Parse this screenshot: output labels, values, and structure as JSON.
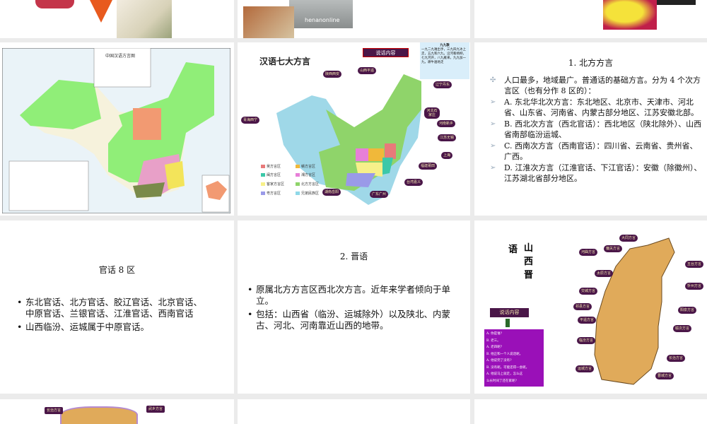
{
  "slides": [
    {
      "id": 1,
      "image_caption": ""
    },
    {
      "id": 2,
      "image_caption": "henanonline"
    },
    {
      "id": 3
    },
    {
      "id": 4,
      "map_title": "中国汉语方言图"
    },
    {
      "id": 5,
      "map_title": "汉语七大方言",
      "button": "说话内容",
      "poem_title": "九九歌",
      "poem": "一九二九难出手，三九四九冰上走，五九和六九，沿河看杨柳，七九河开，八九雁来，九九加一九，耕牛遍地走",
      "tags": [
        "陕西西安",
        "山西平遥",
        "辽宁丹东",
        "河北石家庄",
        "河南新乡",
        "江苏无锡",
        "上海",
        "福建莆田",
        "台湾嘉义",
        "广东广州",
        "湖南岳阳",
        "青海西宁"
      ],
      "legend": [
        {
          "label": "吴方言区",
          "color": "#e87a7a"
        },
        {
          "label": "赣方言区",
          "color": "#f0b83a"
        },
        {
          "label": "闽方言区",
          "color": "#3cc8a8"
        },
        {
          "label": "湘方言区",
          "color": "#e77fd8"
        },
        {
          "label": "客家方言区",
          "color": "#f7f08a"
        },
        {
          "label": "北方方言区",
          "color": "#8fd46a"
        },
        {
          "label": "粤方言区",
          "color": "#9a9ae8"
        },
        {
          "label": "兄弟民族区",
          "color": "#8fd8e8"
        }
      ]
    },
    {
      "id": 6,
      "title": "1. 北方方言",
      "paras": [
        "人口最多，地域最广。普通话的基础方言。分为 4 个次方言区（也有分作 8 区的）：",
        "A. 东北华北次方言：东北地区、北京市、天津市、河北省、山东省、河南省、内蒙古部分地区、江苏安徽北部。",
        "B. 西北次方言（西北官话）：西北地区（陕北除外）、山西省南部临汾运城、",
        "C. 西南次方言（西南官话）：四川省、云南省、贵州省、广西。",
        "D. 江淮次方言（江淮官话、下江官话）：安徽（除徽州）、江苏湖北省部分地区。"
      ]
    },
    {
      "id": 7,
      "title": "官话 8 区",
      "bullets": [
        "东北官话、北方官话、胶辽官话、北京官话、中原官话、兰银官话、江淮官话、西南官话",
        "山西临汾、运城属于中原官话。"
      ]
    },
    {
      "id": 8,
      "title": "2. 晋语",
      "bullets": [
        "原属北方方言区西北次方言。近年来学者倾向于单立。",
        "包括：山西省（临汾、运城除外）以及陕北、内蒙古、河北、河南靠近山西的地带。"
      ]
    },
    {
      "id": 9,
      "title_a": "语",
      "title_b": "山西晋",
      "button": "说话内容",
      "dialogue": [
        "A. 你是谁?",
        "B.  老三。",
        "A. 老四呢?",
        "B. 他正和一个人说话呢。",
        "A. 他说完了没有?",
        "B. 没有呢。可能还得一会呢。",
        "A. 他说马上就走，怎么这",
        "么长时间了还在家呢?"
      ],
      "tags": [
        "大同方言",
        "偏关方言",
        "河曲方言",
        "五台方言",
        "太原方言",
        "忻州方言",
        "交城方言",
        "阳泉方言",
        "祁县方言",
        "平遥方言",
        "榆次方言",
        "临汾方言",
        "长治方言",
        "运城方言",
        "晋城方言"
      ]
    },
    {
      "id": 10,
      "tags": [
        "长治方言",
        "武乡方言"
      ]
    },
    {
      "id": 11
    },
    {
      "id": 12
    }
  ]
}
